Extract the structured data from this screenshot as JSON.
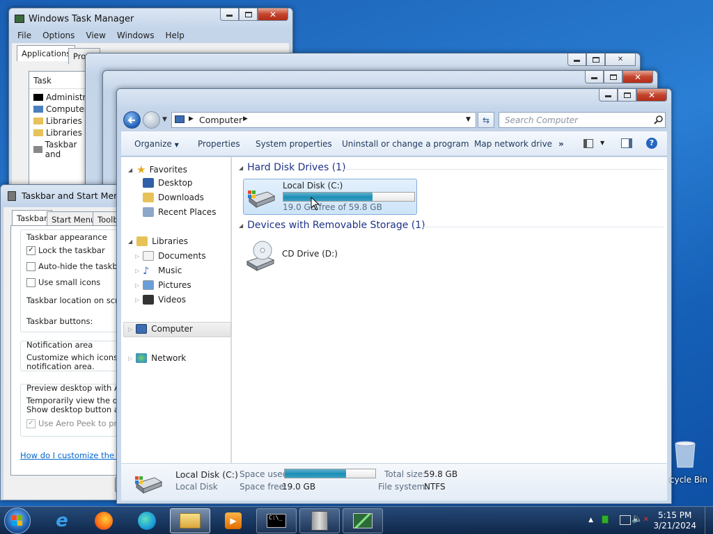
{
  "task_manager": {
    "title": "Windows Task Manager",
    "menu": [
      "File",
      "Options",
      "View",
      "Windows",
      "Help"
    ],
    "tabs": [
      "Applications",
      "Proce"
    ],
    "column_task": "Task",
    "tasks": [
      "Administrato",
      "Computer",
      "Libraries",
      "Libraries",
      "Taskbar and"
    ]
  },
  "taskbar_props": {
    "title": "Taskbar and Start Menu Pr",
    "tabs": [
      "Taskbar",
      "Start Menu",
      "Toolba"
    ],
    "appearance_label": "Taskbar appearance",
    "lock_taskbar": "Lock the taskbar",
    "auto_hide": "Auto-hide the taskbar",
    "small_icons": "Use small icons",
    "location_label": "Taskbar location on screen",
    "buttons_label": "Taskbar buttons:",
    "notification_label": "Notification area",
    "notification_text_1": "Customize which icons and",
    "notification_text_2": "notification area.",
    "preview_label": "Preview desktop with Aero",
    "preview_text_1": "Temporarily view the deskt",
    "preview_text_2": "Show desktop button at en",
    "aero_peek": "Use Aero Peek to previe",
    "help_link": "How do I customize the taskb"
  },
  "explorer": {
    "address_root": "Computer",
    "search_placeholder": "Search Computer",
    "toolbar": {
      "organize": "Organize",
      "properties": "Properties",
      "system_properties": "System properties",
      "uninstall": "Uninstall or change a program",
      "map_drive": "Map network drive",
      "more": "»"
    },
    "nav": {
      "favorites": "Favorites",
      "desktop": "Desktop",
      "downloads": "Downloads",
      "recent": "Recent Places",
      "libraries": "Libraries",
      "documents": "Documents",
      "music": "Music",
      "pictures": "Pictures",
      "videos": "Videos",
      "computer": "Computer",
      "network": "Network"
    },
    "groups": {
      "hdd": "Hard Disk Drives (1)",
      "removable": "Devices with Removable Storage (1)"
    },
    "drive_c": {
      "name": "Local Disk (C:)",
      "free_text": "19.0 GB free of 59.8 GB",
      "used_fraction": 0.68
    },
    "drive_d": {
      "name": "CD Drive (D:)"
    },
    "details": {
      "name": "Local Disk (C:)",
      "type": "Local Disk",
      "space_used_label": "Space used:",
      "space_free_label": "Space free:",
      "space_free": "19.0 GB",
      "total_label": "Total size:",
      "total": "59.8 GB",
      "fs_label": "File system:",
      "fs": "NTFS"
    }
  },
  "desktop": {
    "recycle_bin": "cycle Bin"
  },
  "clock": {
    "time": "5:15 PM",
    "date": "3/21/2024"
  },
  "colors": {
    "link": "#0066cc",
    "group_header": "#1e3287"
  }
}
